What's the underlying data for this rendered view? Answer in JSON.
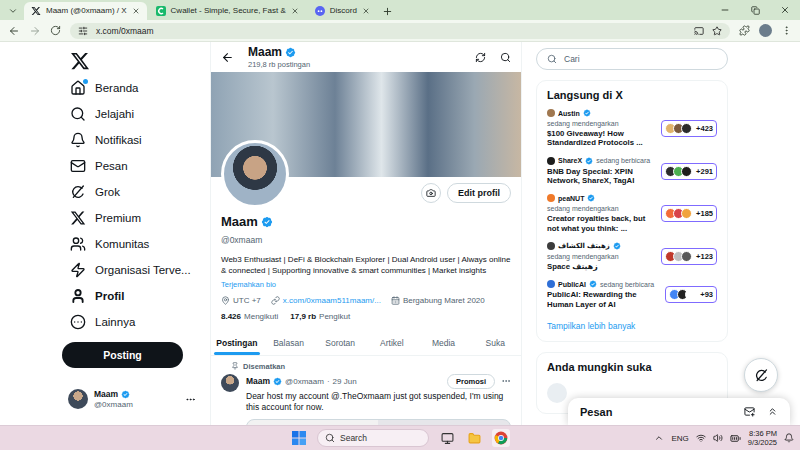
{
  "browser": {
    "tabs": [
      {
        "label": "Maam (@0xmaam) / X",
        "selected": true
      },
      {
        "label": "Cwallet - Simple, Secure, Fast &",
        "selected": false
      },
      {
        "label": "Discord",
        "selected": false
      }
    ],
    "address": "x.com/0xmaam"
  },
  "sidebar": {
    "items": [
      {
        "label": "Beranda",
        "selected": false,
        "badge": true
      },
      {
        "label": "Jelajahi",
        "selected": false,
        "badge": false
      },
      {
        "label": "Notifikasi",
        "selected": false,
        "badge": false
      },
      {
        "label": "Pesan",
        "selected": false,
        "badge": false
      },
      {
        "label": "Grok",
        "selected": false,
        "badge": false
      },
      {
        "label": "Premium",
        "selected": false,
        "badge": false
      },
      {
        "label": "Komunitas",
        "selected": false,
        "badge": false
      },
      {
        "label": "Organisasi Terve...",
        "selected": false,
        "badge": false
      },
      {
        "label": "Profil",
        "selected": true,
        "badge": false
      },
      {
        "label": "Lainnya",
        "selected": false,
        "badge": false
      }
    ],
    "post_button": "Posting",
    "account": {
      "name": "Maam",
      "handle": "@0xmaam",
      "verified": true
    }
  },
  "profile_header": {
    "name": "Maam",
    "verified": true,
    "posts": "219,8 rb postingan"
  },
  "profile": {
    "edit_button": "Edit profil",
    "name": "Maam",
    "verified": true,
    "handle": "@0xmaam",
    "bio": "Web3 Enthusiast | DeFi & Blockchain Explorer | Dual Android user | Always online & connected | Supporting innovative & smart communities | Market insights",
    "translate": "Terjemahkan bio",
    "location": "UTC +7",
    "link": "x.com/0xmaam511maam/...",
    "joined": "Bergabung Maret 2020",
    "following": {
      "count": "8.426",
      "label": "Mengikuti"
    },
    "followers": {
      "count": "17,9 rb",
      "label": "Pengikut"
    }
  },
  "tabs": [
    {
      "label": "Postingan",
      "selected": true
    },
    {
      "label": "Balasan",
      "selected": false
    },
    {
      "label": "Sorotan",
      "selected": false
    },
    {
      "label": "Artikel",
      "selected": false
    },
    {
      "label": "Media",
      "selected": false
    },
    {
      "label": "Suka",
      "selected": false
    }
  ],
  "pinned_post": {
    "pinned_label": "Disematkan",
    "author": "Maam",
    "verified": true,
    "handle": "@0xmaam",
    "separator": "·",
    "time": "29 Jun",
    "promote": "Promosi",
    "text": "Dear host my account @.TheOxmaam just got suspended, I'm using this account for now."
  },
  "search": {
    "placeholder": "Cari"
  },
  "live": {
    "title": "Langsung di X",
    "items": [
      {
        "host": "Austin",
        "verified": true,
        "status": "sedang mendengarkan",
        "title": "$100 Giveaway! How Standardized Protocols ...",
        "count": "+423"
      },
      {
        "host": "ShareX",
        "verified": true,
        "status": "sedang berbicara",
        "title": "BNB Day Special: XPIN Network, ShareX, TagAI",
        "count": "+291"
      },
      {
        "host": "peaNUT",
        "verified": true,
        "status": "sedang mendengarkan",
        "title": "Creator royalties back, but not what you think: ...",
        "count": "+185"
      },
      {
        "host": "زهيتف الكشاف",
        "verified": true,
        "status": "sedang mendengarkan",
        "title": "Space زهيتف",
        "count": "+123"
      },
      {
        "host": "PublicAI",
        "verified": true,
        "status": "sedang berbicara",
        "title": "PublicAI: Rewarding the Human Layer of AI",
        "count": "+93"
      }
    ],
    "more": "Tampilkan lebih banyak"
  },
  "suggest": {
    "title": "Anda mungkin suka"
  },
  "messages": {
    "title": "Pesan"
  },
  "taskbar": {
    "search": "Search",
    "language": "ENG",
    "time": "8:36 PM",
    "date": "9/3/2025"
  }
}
